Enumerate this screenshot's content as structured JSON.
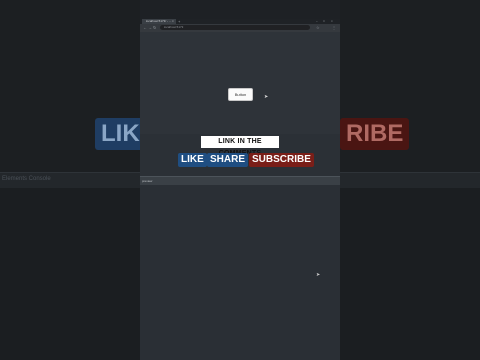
{
  "background": {
    "ghost_like": "LIKE",
    "ghost_subscribe": "RIBE",
    "strip_text": "Elements Console"
  },
  "browser": {
    "tab_title": "localhost:5173/ - ...",
    "tab_close": "×",
    "new_tab": "+",
    "window_controls": [
      "–",
      "□",
      "×"
    ],
    "nav": {
      "back": "←",
      "forward": "→",
      "reload": "↻"
    },
    "url": "localhost:5173",
    "toolbar_icons": [
      "☆",
      "⋮"
    ]
  },
  "page": {
    "button_label": "Button"
  },
  "overlay": {
    "comments": "LINK IN THE COMMENTS",
    "like": "LIKE",
    "share": "SHARE",
    "subscribe": "SUBSCRIBE"
  },
  "lower": {
    "header": "preview",
    "center_text": "",
    "footer_left": "",
    "footer_right": ""
  }
}
